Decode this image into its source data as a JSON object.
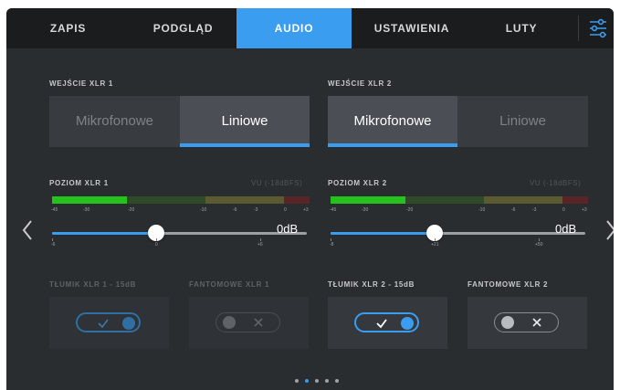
{
  "tabs": [
    {
      "label": "ZAPIS"
    },
    {
      "label": "PODGLĄD"
    },
    {
      "label": "AUDIO"
    },
    {
      "label": "USTAWIENIA"
    },
    {
      "label": "LUTY"
    }
  ],
  "active_tab": "AUDIO",
  "colors": {
    "accent": "#3a9df0",
    "background": "#2a2d30",
    "tabbar": "#1b1c1e"
  },
  "channels": [
    {
      "input_label": "WEJŚCIE XLR 1",
      "options": [
        "Mikrofonowe",
        "Liniowe"
      ],
      "selected": "Liniowe",
      "level_label": "POZIOM XLR 1",
      "vu_label": "VU (-18dBFS)",
      "meter_scale": [
        "-45",
        "-30",
        "-20",
        "-10",
        "-6",
        "-3",
        "0",
        "+3"
      ],
      "slider_scale": [
        "-6",
        "0",
        "+6"
      ],
      "gain_value": "0dB",
      "slider_level": 0.41,
      "attenuator_label": "TŁUMIK XLR 1 - 15dB",
      "attenuator_on": true,
      "attenuator_enabled": false,
      "phantom_label": "FANTOMOWE XLR 1",
      "phantom_on": false,
      "phantom_enabled": false
    },
    {
      "input_label": "WEJŚCIE XLR 2",
      "options": [
        "Mikrofonowe",
        "Liniowe"
      ],
      "selected": "Mikrofonowe",
      "level_label": "POZIOM XLR 2",
      "vu_label": "VU (-18dBFS)",
      "meter_scale": [
        "-45",
        "-30",
        "-20",
        "-10",
        "-6",
        "-3",
        "0",
        "+3"
      ],
      "slider_scale": [
        "-8",
        "+21",
        "+50"
      ],
      "gain_value": "0dB",
      "slider_level": 0.41,
      "attenuator_label": "TŁUMIK XLR 2 - 15dB",
      "attenuator_on": true,
      "attenuator_enabled": true,
      "phantom_label": "FANTOMOWE XLR 2",
      "phantom_on": false,
      "phantom_enabled": true
    }
  ],
  "pager": {
    "pages": 5,
    "active": 2
  },
  "icons": {
    "settings": "sliders-icon",
    "prev": "chevron-left-icon",
    "next": "chevron-right-icon",
    "check": "check-icon",
    "cross": "x-icon"
  }
}
